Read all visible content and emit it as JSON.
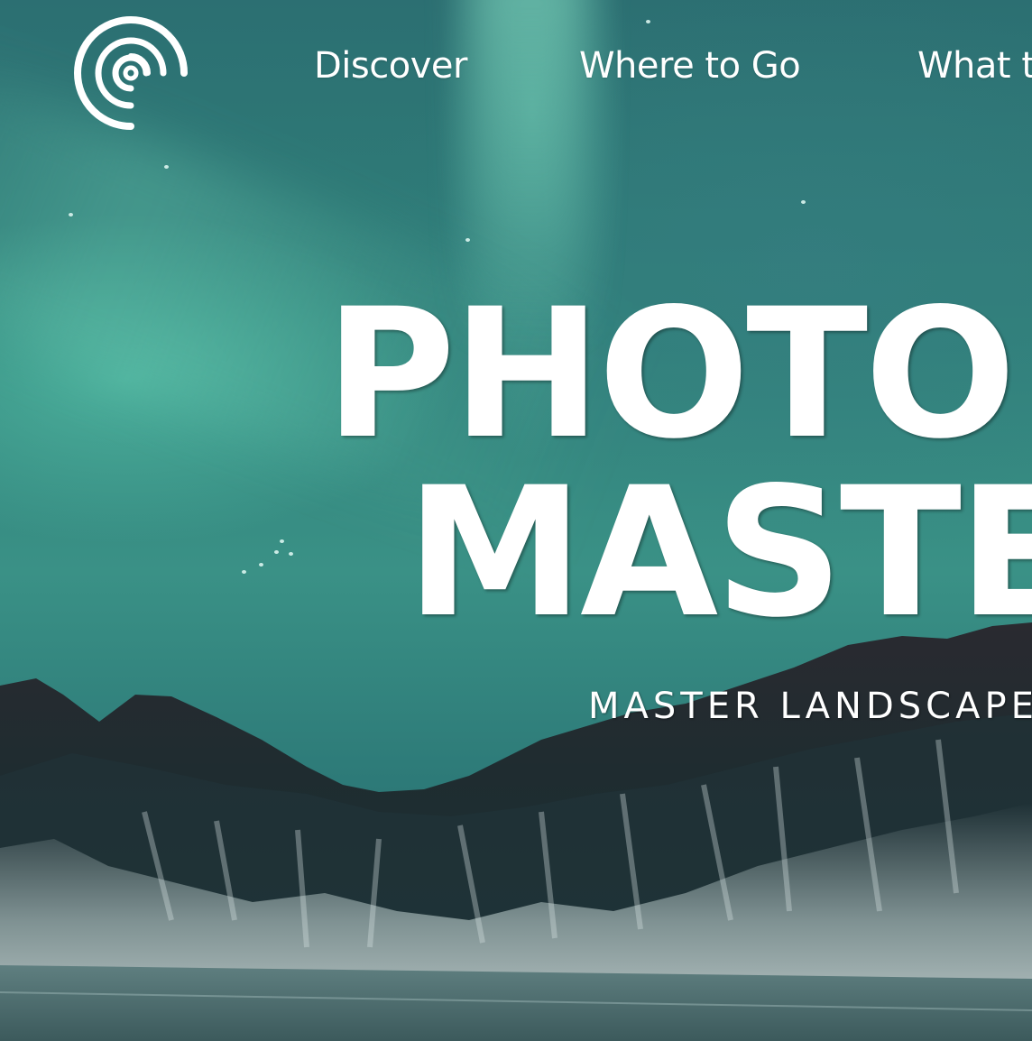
{
  "nav": {
    "items": [
      {
        "label": "Discover"
      },
      {
        "label": "Where to Go"
      },
      {
        "label": "What to"
      }
    ]
  },
  "hero": {
    "title_line1": "PHOTO",
    "title_line2": "MASTE",
    "subtitle": "MASTER LANDSCAPE"
  },
  "icons": {
    "logo": "concentric-swirl-logo-icon"
  },
  "colors": {
    "sky": "#2f8079",
    "text": "#ffffff",
    "mountain_dark": "#1c2b2e",
    "snow": "#d8e6e4"
  }
}
